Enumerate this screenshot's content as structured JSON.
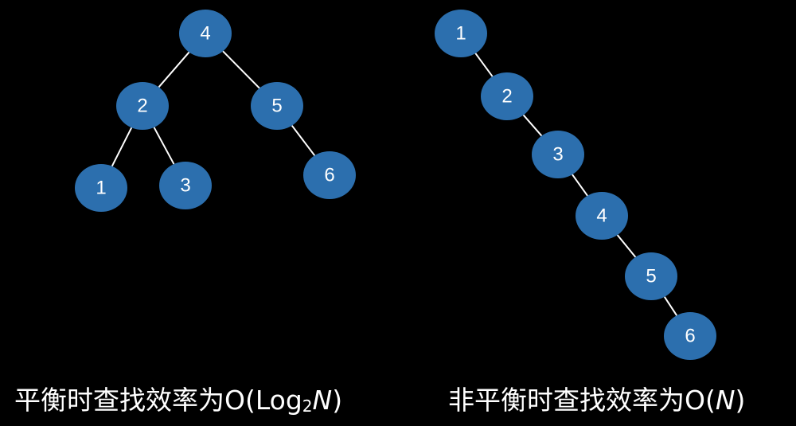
{
  "balanced_tree": {
    "nodes": [
      {
        "id": "b4",
        "label": "4"
      },
      {
        "id": "b2",
        "label": "2"
      },
      {
        "id": "b5",
        "label": "5"
      },
      {
        "id": "b1",
        "label": "1"
      },
      {
        "id": "b3",
        "label": "3"
      },
      {
        "id": "b6",
        "label": "6"
      }
    ],
    "edges": [
      [
        "b4",
        "b2"
      ],
      [
        "b4",
        "b5"
      ],
      [
        "b2",
        "b1"
      ],
      [
        "b2",
        "b3"
      ],
      [
        "b5",
        "b6"
      ]
    ],
    "caption": {
      "prefix": "平衡时查找效率为O(Log",
      "subscript": "2",
      "variable": "N",
      "suffix": ")"
    }
  },
  "unbalanced_tree": {
    "nodes": [
      {
        "id": "u1",
        "label": "1"
      },
      {
        "id": "u2",
        "label": "2"
      },
      {
        "id": "u3",
        "label": "3"
      },
      {
        "id": "u4",
        "label": "4"
      },
      {
        "id": "u5",
        "label": "5"
      },
      {
        "id": "u6",
        "label": "6"
      }
    ],
    "edges": [
      [
        "u1",
        "u2"
      ],
      [
        "u2",
        "u3"
      ],
      [
        "u3",
        "u4"
      ],
      [
        "u4",
        "u5"
      ],
      [
        "u5",
        "u6"
      ]
    ],
    "caption": {
      "prefix": "非平衡时查找效率为O(",
      "variable": "N",
      "suffix": ")"
    }
  },
  "colors": {
    "node_fill": "#2c6fae",
    "edge": "#ffffff",
    "background": "#000000",
    "text": "#ffffff"
  }
}
